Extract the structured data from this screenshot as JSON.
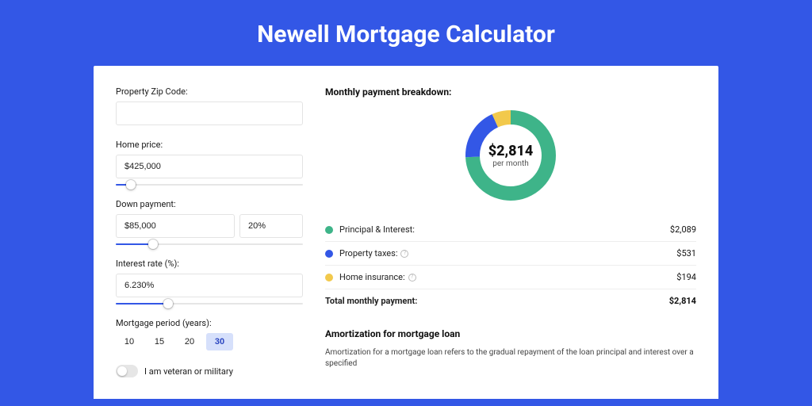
{
  "page": {
    "title": "Newell Mortgage Calculator"
  },
  "form": {
    "zip": {
      "label": "Property Zip Code:",
      "value": ""
    },
    "price": {
      "label": "Home price:",
      "value": "$425,000",
      "slider_pct": 8
    },
    "down": {
      "label": "Down payment:",
      "value": "$85,000",
      "pct": "20%",
      "slider_pct": 20
    },
    "rate": {
      "label": "Interest rate (%):",
      "value": "6.230%",
      "slider_pct": 28
    },
    "period": {
      "label": "Mortgage period (years):",
      "options": [
        "10",
        "15",
        "20",
        "30"
      ],
      "selected": "30"
    },
    "vet": {
      "label": "I am veteran or military",
      "on": false
    }
  },
  "breakdown": {
    "title": "Monthly payment breakdown:",
    "donut": {
      "value": "$2,814",
      "sub": "per month"
    },
    "rows": [
      {
        "color": "#3eb489",
        "label": "Principal & Interest:",
        "info": false,
        "value": "$2,089"
      },
      {
        "color": "#3357e6",
        "label": "Property taxes:",
        "info": true,
        "value": "$531"
      },
      {
        "color": "#f2c94c",
        "label": "Home insurance:",
        "info": true,
        "value": "$194"
      }
    ],
    "total": {
      "label": "Total monthly payment:",
      "value": "$2,814"
    }
  },
  "amort": {
    "title": "Amortization for mortgage loan",
    "body": "Amortization for a mortgage loan refers to the gradual repayment of the loan principal and interest over a specified"
  },
  "chart_data": {
    "type": "pie",
    "title": "Monthly payment breakdown",
    "series": [
      {
        "name": "Principal & Interest",
        "value": 2089,
        "color": "#3eb489"
      },
      {
        "name": "Property taxes",
        "value": 531,
        "color": "#3357e6"
      },
      {
        "name": "Home insurance",
        "value": 194,
        "color": "#f2c94c"
      }
    ],
    "total": 2814,
    "center_label": "$2,814 per month"
  }
}
